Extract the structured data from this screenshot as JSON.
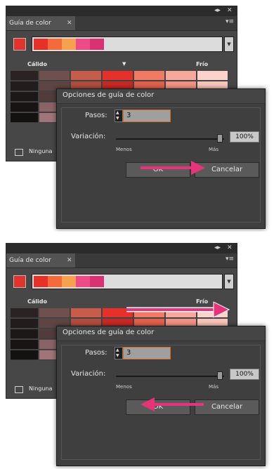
{
  "panel": {
    "collapse_glyph": "◂▸",
    "close_glyph": "✕",
    "tab_title": "Guía de color",
    "tab_close_glyph": "✕",
    "menu_glyph": "▾≡",
    "dropdown_glyph": "▼",
    "warm_label": "Cálido",
    "cool_label": "Frío",
    "arrow_glyph": "▼",
    "bottom_label": "Ninguna",
    "base_color": "#e2332c",
    "harmony_colors": [
      "#e5312a",
      "#f36b3b",
      "#f7a14f",
      "#ee4a86",
      "#d93273"
    ],
    "grid_colors": [
      [
        "#2a2322",
        "#6f504c",
        "#c75c4a",
        "#e5312a",
        "#f07a62",
        "#f6a89a",
        "#fbd3cb"
      ],
      [
        "#221c1c",
        "#5f4541",
        "#b14e3f",
        "#c72a24",
        "#e1614d",
        "#f19384",
        "#f8c4ba"
      ],
      [
        "#1d1818",
        "#523c39",
        "#9c4537",
        "#ab241f",
        "#cf5442",
        "#e58274",
        "#f3b5aa"
      ],
      [
        "#181414",
        "#8a6366",
        "#7f3a30",
        "#8f1f1a",
        "#b7473a",
        "#d67163",
        "#eaa69b"
      ],
      [
        "#141111",
        "#a07479",
        "#6b3129",
        "#781a16",
        "#9f3d32",
        "#c46256",
        "#e0988d"
      ]
    ]
  },
  "dialog": {
    "title": "Opciones de guía de color",
    "steps_label": "Pasos:",
    "steps_value": "3",
    "stepper_up": "▲",
    "stepper_down": "▼",
    "variation_label": "Variación:",
    "variation_percent": "100%",
    "min_label": "Menos",
    "max_label": "Más",
    "ok_label": "OK",
    "cancel_label": "Cancelar"
  },
  "annotations": {
    "arrow_color": "#e6337a"
  }
}
